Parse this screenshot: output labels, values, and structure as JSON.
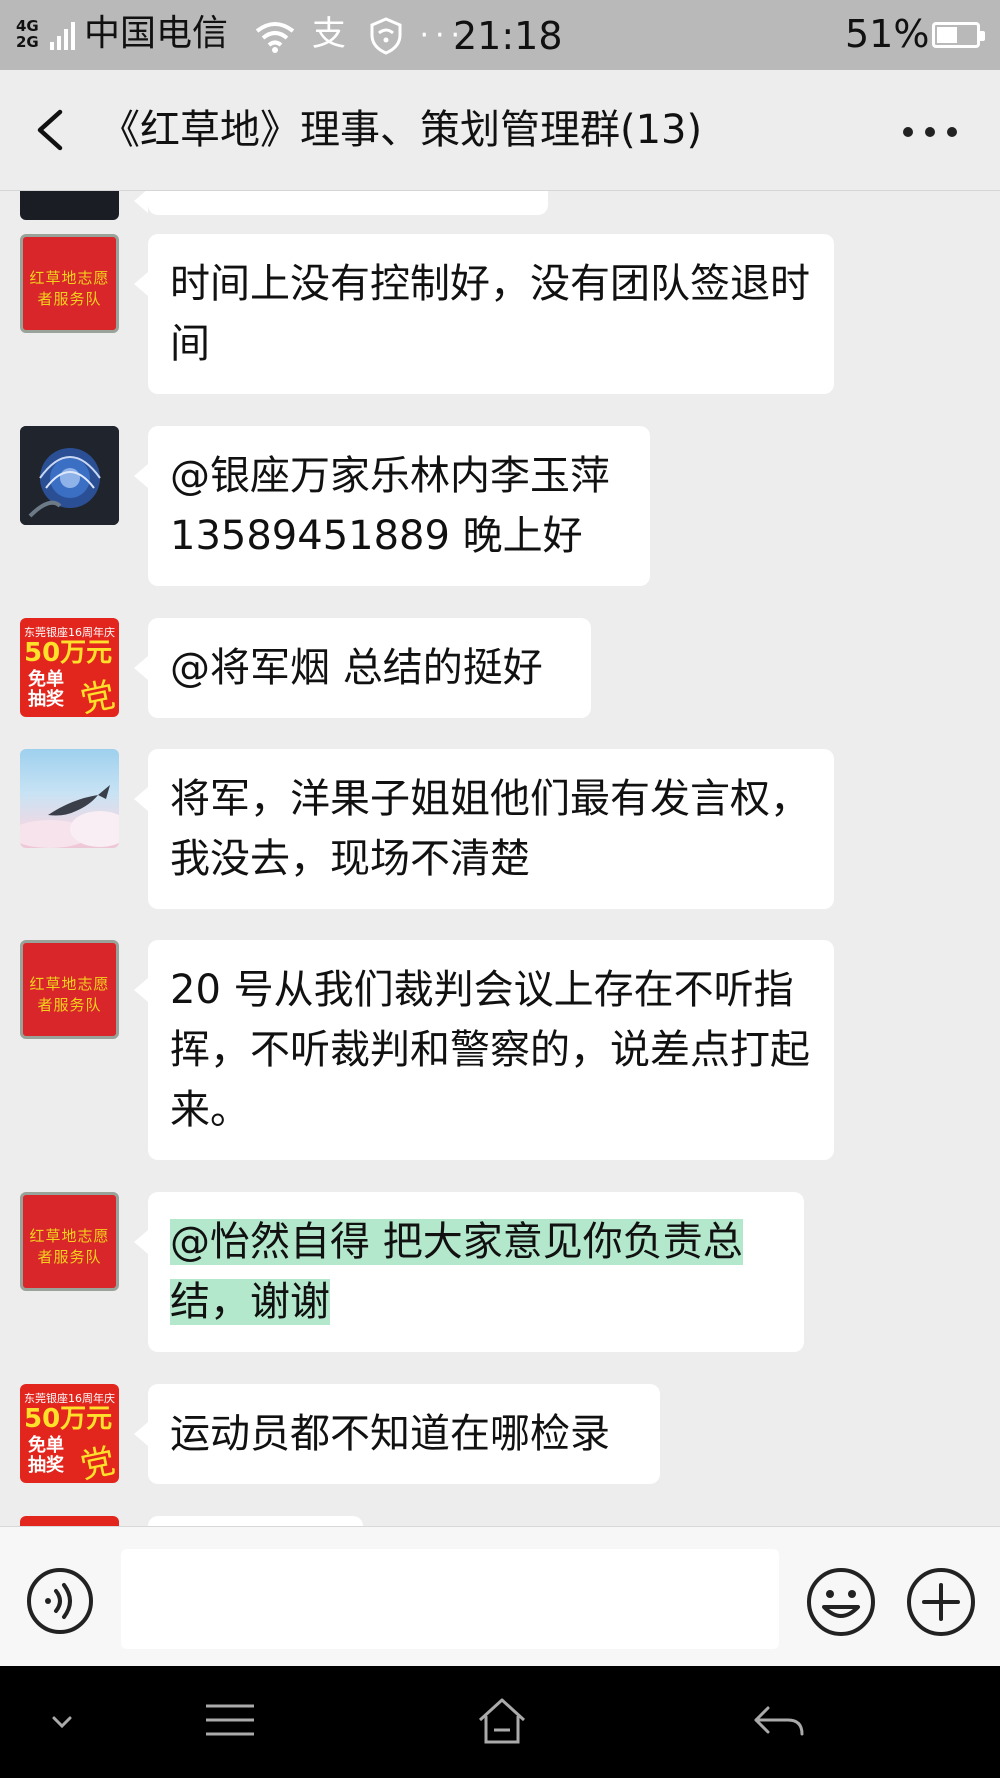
{
  "status_bar": {
    "network": "4G\n2G",
    "carrier": "中国电信",
    "time": "21:18",
    "battery": "51%",
    "battery_level": 0.51,
    "icons": [
      "wifi-icon",
      "alipay-icon",
      "shield-icon",
      "more-dots-icon"
    ]
  },
  "header": {
    "title": "《红草地》理事、策划管理群(13)"
  },
  "avatars": {
    "red_banner_text": "红草地志愿者服务队",
    "promo_top": "东莞银座16周年庆",
    "promo_big": "50万元",
    "promo_mid": "免单抽奖",
    "promo_char": "党"
  },
  "messages": [
    {
      "avatar": "red-banner",
      "text": "时间上没有控制好，没有团队签退时间"
    },
    {
      "avatar": "blue-rose",
      "text": "@银座万家乐林内李玉萍 13589451889  晚上好"
    },
    {
      "avatar": "promo",
      "text": "@将军烟  总结的挺好"
    },
    {
      "avatar": "whale",
      "text": "将军，洋果子姐姐他们最有发言权，我没去，现场不清楚"
    },
    {
      "avatar": "red-banner",
      "text": "20 号从我们裁判会议上存在不听指挥，不听裁判和警察的，说差点打起来。"
    },
    {
      "avatar": "red-banner",
      "text_line1": "@怡然自得  把大家意见你负责总",
      "text_line2": "结，谢谢",
      "highlighted": true
    },
    {
      "avatar": "promo",
      "text": "运动员都不知道在哪检录"
    }
  ],
  "input": {
    "value": "",
    "placeholder": ""
  },
  "colors": {
    "chat_bg": "#ededed",
    "bubble_bg": "#ffffff",
    "highlight": "#b4e8cc",
    "status_bar": "#b9b9b9",
    "nav_bar": "#000000"
  }
}
